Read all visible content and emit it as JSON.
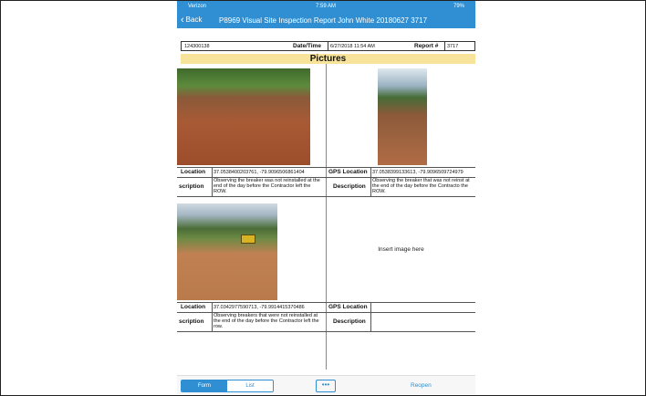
{
  "status_bar": {
    "carrier": "Verizon",
    "time": "7:59 AM",
    "battery": "79%"
  },
  "nav": {
    "back_label": "Back",
    "title": "P8969 Visual Site Inspection Report John White 20180627 3717"
  },
  "report": {
    "id": "124300138",
    "datetime_label": "Date/Time",
    "datetime_value": "6/27/2018 11:54 AM",
    "report_label": "Report #",
    "report_value": "3717",
    "section_title": "Pictures"
  },
  "entries": [
    {
      "location_label": "Location",
      "location_value": "37.0538400203761, -79.9096506861404",
      "description_label": "scription",
      "description_value": "Observing the breaker was not reinstalled at the end of the day before the Contractor left the ROW."
    },
    {
      "location_label": "GPS Location",
      "location_value": "37.0538399133613, -79.9096509724979",
      "description_label": "Description",
      "description_value": "Observing the breaker that was not reinst at the end of the day before the Contracto the ROW."
    },
    {
      "location_label": "Location",
      "location_value": "37.0342977590713, -79.9914415370486",
      "description_label": "scription",
      "description_value": "Observing breakers that were not reinstalled at the end of the day before the Contractor left the row."
    },
    {
      "location_label": "GPS Location",
      "location_value": "",
      "description_label": "Description",
      "description_value": ""
    }
  ],
  "insert_image_text": "Insert image here",
  "toolbar": {
    "form_label": "Form",
    "list_label": "List",
    "more_label": "•••",
    "reopen_label": "Reopen"
  },
  "colors": {
    "accent": "#2f8fd2",
    "section_bg": "#f7e39a"
  }
}
